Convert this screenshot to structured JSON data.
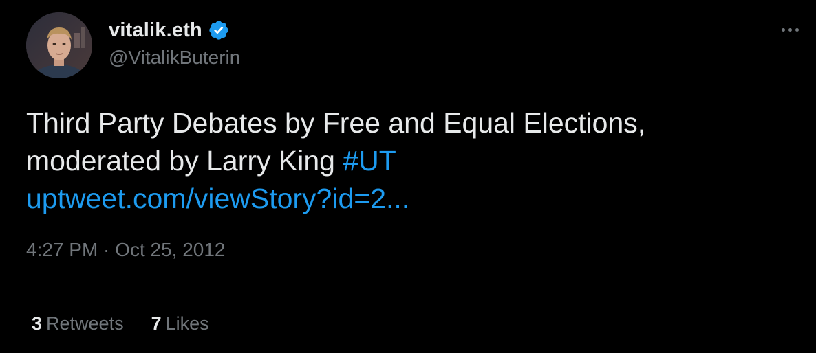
{
  "user": {
    "display_name": "vitalik.eth",
    "handle": "@VitalikButerin",
    "verified": true
  },
  "tweet": {
    "text_line1": "Third Party Debates by Free and Equal Elections,",
    "text_line2_prefix": "moderated by Larry King",
    "hashtag": "#UT",
    "link": "uptweet.com/viewStory?id=2...",
    "timestamp": "4:27 PM · Oct 25, 2012"
  },
  "stats": {
    "retweets_count": "3",
    "retweets_label": "Retweets",
    "likes_count": "7",
    "likes_label": "Likes"
  },
  "icons": {
    "verified": "verified-badge-icon",
    "more": "more-options-icon"
  },
  "colors": {
    "background": "#000000",
    "text": "#e7e9ea",
    "secondary": "#71767b",
    "accent": "#1d9bf0",
    "divider": "#2f3336"
  }
}
